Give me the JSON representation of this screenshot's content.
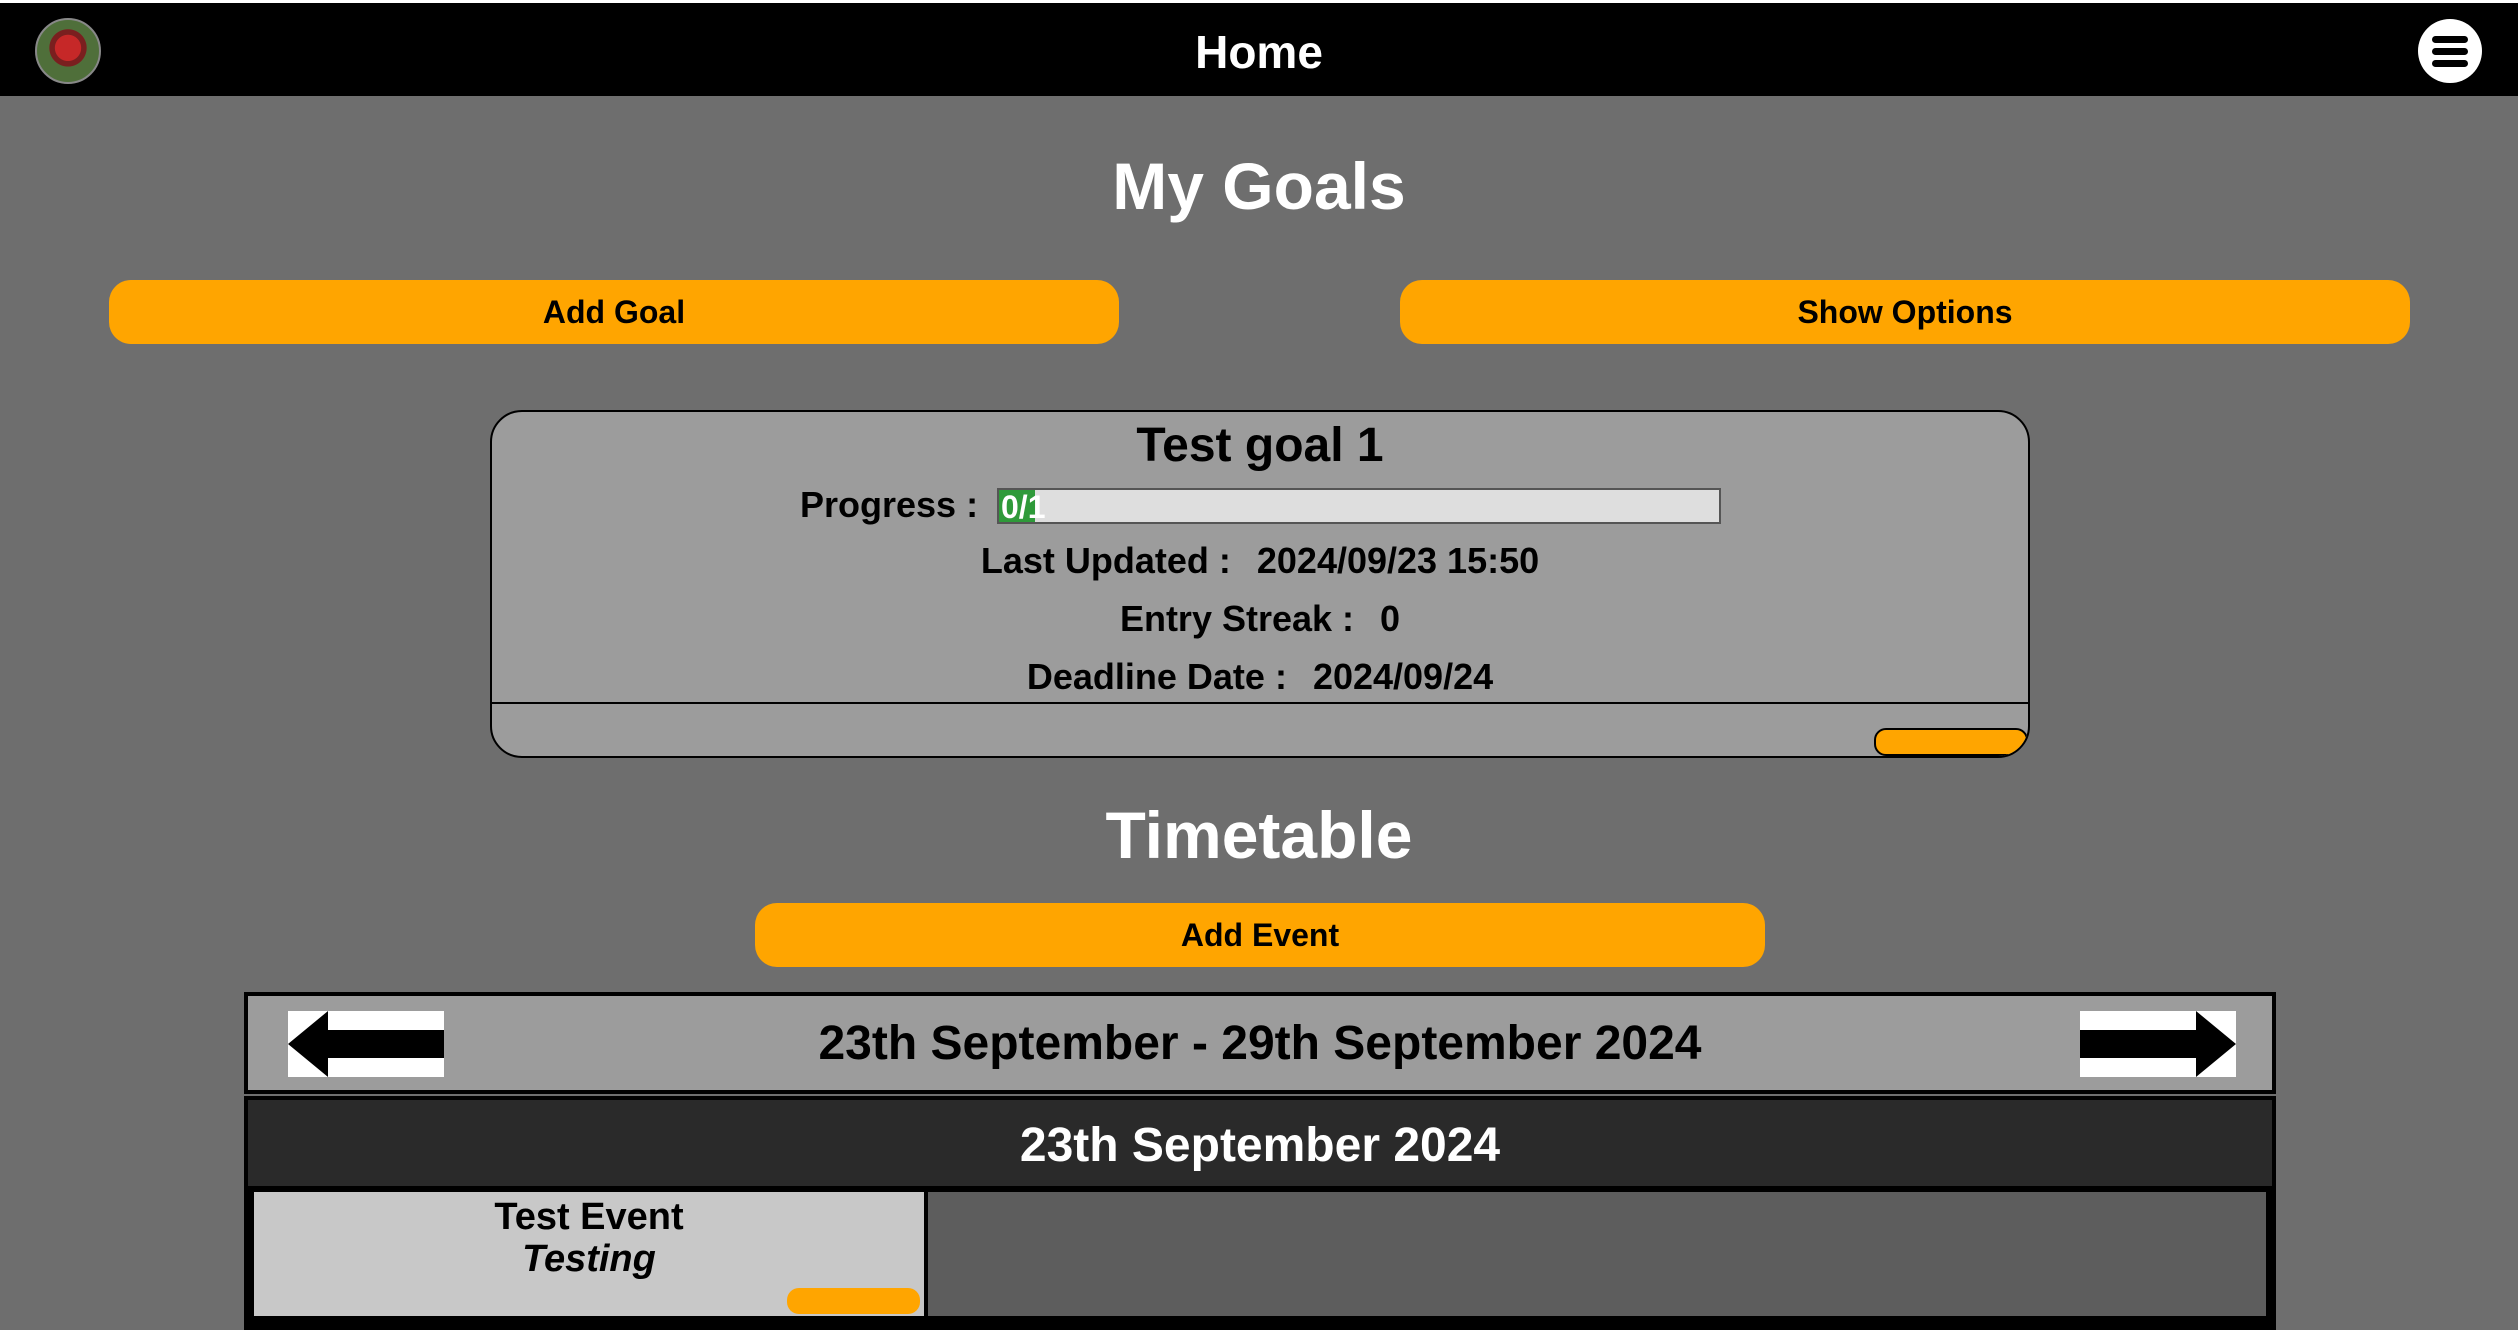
{
  "header": {
    "title": "Home",
    "avatar_icon": "user-avatar",
    "menu_icon": "hamburger-menu-icon"
  },
  "goals": {
    "section_title": "My Goals",
    "add_goal_label": "Add Goal",
    "show_options_label": "Show Options",
    "items": [
      {
        "title": "Test goal 1",
        "progress_label": "Progress :",
        "progress_text": "0/1",
        "progress_fraction": 0.05,
        "last_updated_label": "Last Updated :",
        "last_updated_value": "2024/09/23 15:50",
        "entry_streak_label": "Entry Streak :",
        "entry_streak_value": "0",
        "deadline_label": "Deadline Date :",
        "deadline_value": "2024/09/24"
      }
    ]
  },
  "timetable": {
    "section_title": "Timetable",
    "add_event_label": "Add Event",
    "week_label": "23th September - 29th September 2024",
    "prev_icon": "arrow-left-icon",
    "next_icon": "arrow-right-icon",
    "days": [
      {
        "date_label": "23th September 2024",
        "events": [
          {
            "title": "Test Event",
            "description": "Testing"
          }
        ]
      }
    ]
  },
  "colors": {
    "background": "#6e6e6e",
    "accent": "#ffa500",
    "card": "#9c9c9c",
    "progress_fill": "#2f9a3a",
    "topbar": "#000000"
  }
}
